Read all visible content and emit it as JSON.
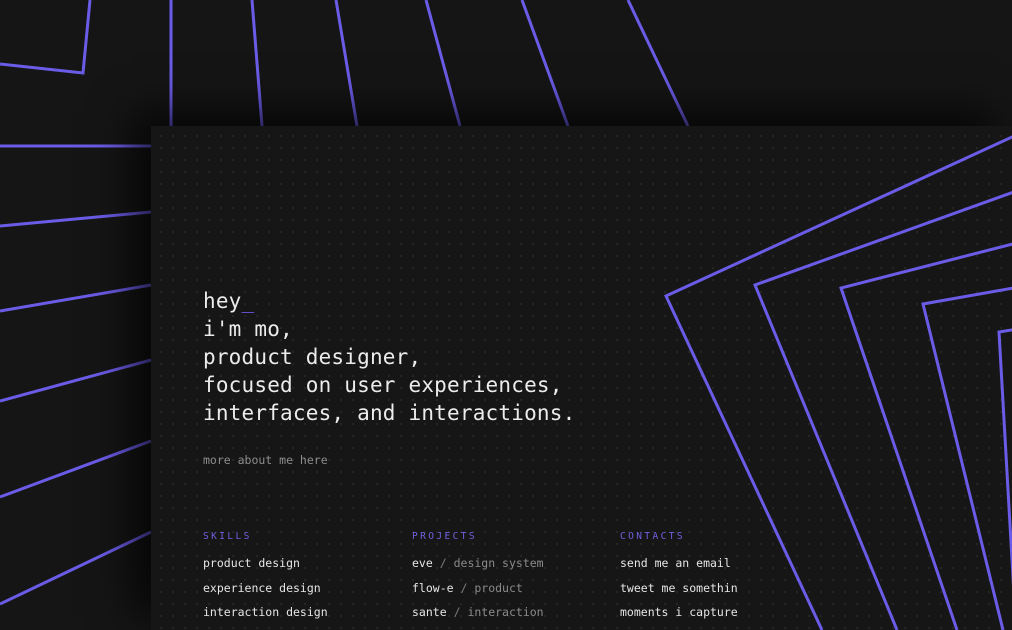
{
  "colors": {
    "accent": "#6b5ce7",
    "background": "#151515",
    "card": "#161616",
    "text": "#ececec",
    "muted": "#8d8d8d"
  },
  "hero": {
    "greeting": "hey",
    "cursor": "_",
    "line2": "i'm mo,",
    "line3": "product designer,",
    "line4": "focused on user experiences,",
    "line5": "interfaces, and interactions."
  },
  "more_link": "more about me here",
  "skills": {
    "title": "SKILLS",
    "items": [
      "product design",
      "experience design",
      "interaction design"
    ]
  },
  "projects": {
    "title": "PROJECTS",
    "separator": "/",
    "items": [
      {
        "name": "eve",
        "category": "design system"
      },
      {
        "name": "flow-e",
        "category": "product"
      },
      {
        "name": "sante",
        "category": "interaction"
      }
    ]
  },
  "contacts": {
    "title": "CONTACTS",
    "items": [
      "send me an email",
      "tweet me somethin",
      "moments i capture"
    ]
  }
}
